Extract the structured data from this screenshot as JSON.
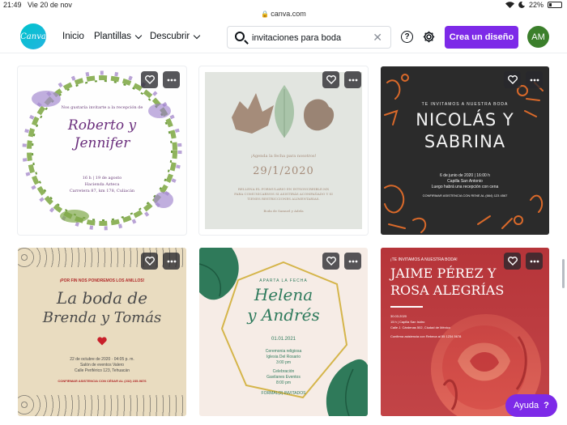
{
  "status": {
    "time": "21:49",
    "date": "Vie 20 de nov",
    "battery": "22%"
  },
  "browser": {
    "url": "canva.com"
  },
  "header": {
    "logo_text": "Canva",
    "nav": {
      "home": "Inicio",
      "templates": "Plantillas",
      "discover": "Descubrir"
    },
    "search": {
      "value": "invitaciones para boda"
    },
    "cta_label": "Crea un diseño",
    "avatar_initials": "AM"
  },
  "cards": [
    {
      "intro": "Nos gustaría invitarte a la recepción de",
      "names_line1": "Roberto y",
      "names_line2": "Jennifer",
      "details_1": "16 h | 19 de agosto",
      "details_2": "Hacienda Azteca",
      "details_3": "Carretera 87, km 178, Culiacán"
    },
    {
      "intro": "¡Agenda la fecha para nosotros!",
      "date": "29/1/2020",
      "details_1": "RELLENA EL FORMULARIO EN INTSONCREIBLE.MX",
      "details_2": "PARA COMUNICARNOS SI ASISTIRÁS ACOMPAÑADO Y SI",
      "details_3": "TIENES RESTRICCIONES ALIMENTARIAS.",
      "footer": "Boda de Samuel y Adela"
    },
    {
      "intro": "TE INVITAMOS A NUESTRA BODA",
      "names_line1": "NICOLÁS Y",
      "names_line2": "SABRINA",
      "details_1": "6 de junio de 2020 | 16:00 h",
      "details_2": "Capilla San Antonio",
      "details_3": "Luego habrá una recepción con cena",
      "footer": "CONFIRMAR ASISTENCIA CON RENE AL (664) 123 4567"
    },
    {
      "intro": "¡POR FIN NOS PONDREMOS LOS ANILLOS!",
      "names_line1": "La boda de",
      "names_line2": "Brenda y Tomás",
      "details_1": "22 de octubre de 2020 · 04:05 p. m.",
      "details_2": "Salón de eventos Valero",
      "details_3": "Calle Periférico 123, Tehuacán",
      "footer": "CONFIRMAR ASISTENCIA CON CÉSAR AL (232) 235-9876"
    },
    {
      "intro": "APARTA LA FECHA",
      "names_line1": "Helena",
      "names_line2": "y Andrés",
      "date": "01.01.2021",
      "details_1": "Ceremonia religiosa",
      "details_2": "Iglesia Del Rosario",
      "details_3": "3:00 pm",
      "details_4": "Celebración",
      "details_5": "Gavilanes Eventos",
      "details_6": "8:00 pm",
      "footer": "FORMAL(2) INVITADOS"
    },
    {
      "intro": "¡TE INVITAMOS A NUESTRA BODA!",
      "names_line1": "JAIME PÉREZ Y",
      "names_line2": "ROSA ALEGRÍAS",
      "date": "30.03.2020",
      "details_1": "15 h | Capilla San Isidro",
      "details_2": "Calle J. Cárdenas 502, Ciudad de México",
      "details_3": "Confirma asistencia con Rebeca al 55 1234 5678"
    }
  ],
  "help_label": "Ayuda",
  "help_icon": "?",
  "colors": {
    "accent": "#7d2ae8",
    "logo": "#00c4cc",
    "avatar": "#3b7f2b"
  }
}
